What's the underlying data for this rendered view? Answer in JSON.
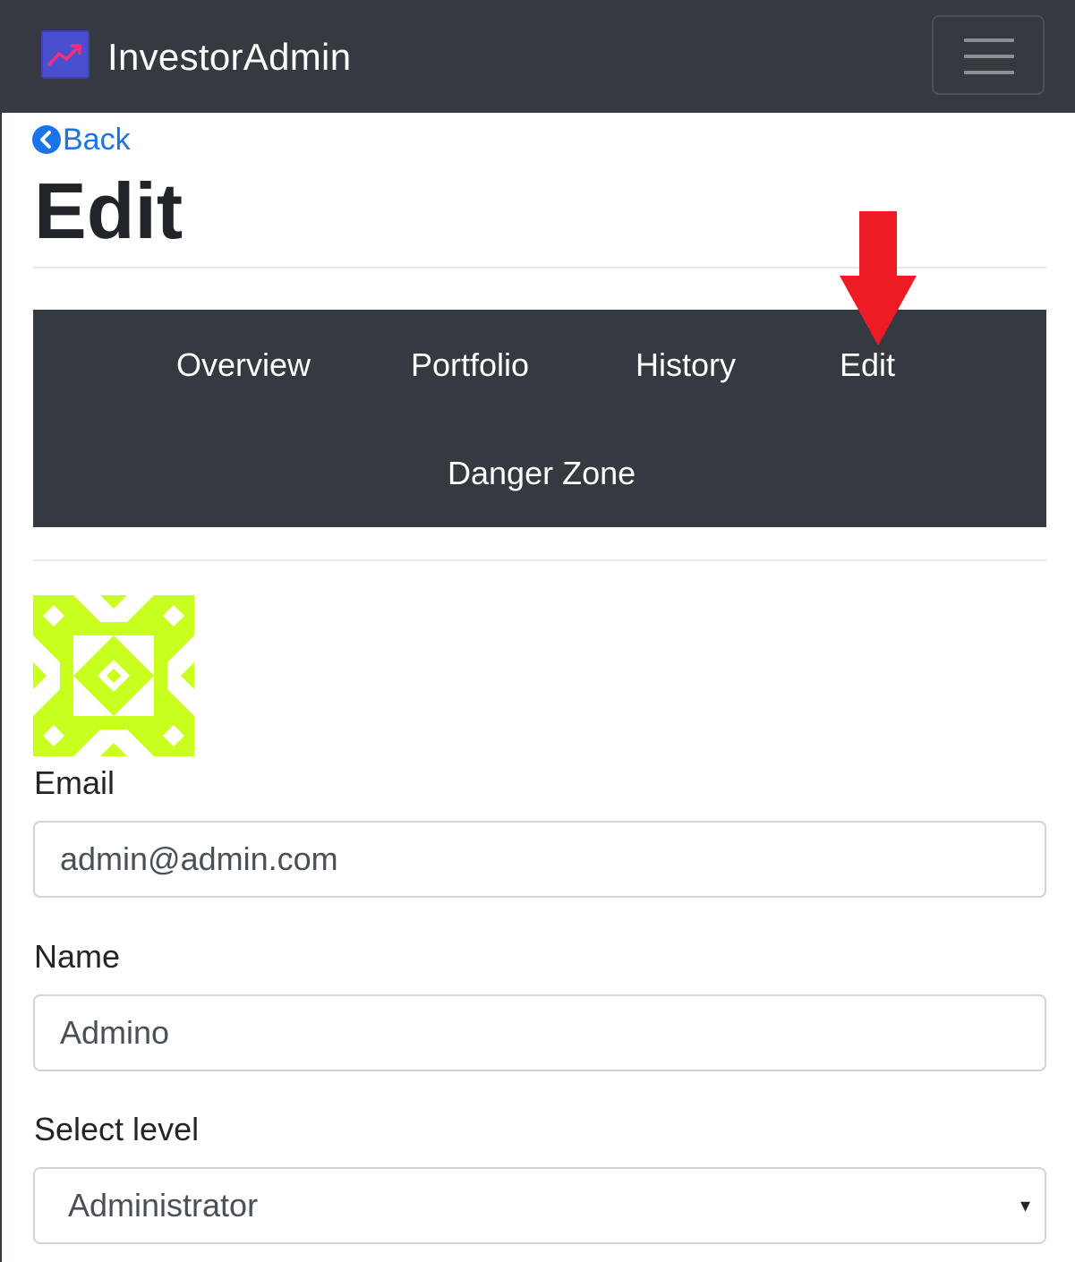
{
  "navbar": {
    "brand": "InvestorAdmin",
    "logo_icon": "trending-up-icon",
    "menu_icon": "hamburger-menu-icon"
  },
  "back": {
    "label": "Back",
    "icon": "chevron-left-circle-icon"
  },
  "page": {
    "title": "Edit"
  },
  "tabs": [
    {
      "label": "Overview"
    },
    {
      "label": "Portfolio"
    },
    {
      "label": "History"
    },
    {
      "label": "Edit"
    },
    {
      "label": "Danger Zone"
    }
  ],
  "annotation": {
    "arrow_icon": "red-down-arrow-icon",
    "arrow_color": "#ed1c24"
  },
  "avatar": {
    "icon": "identicon-avatar",
    "color": "#c8ff1c"
  },
  "form": {
    "email_label": "Email",
    "email_value": "admin@admin.com",
    "name_label": "Name",
    "name_value": "Admino",
    "level_label": "Select level",
    "level_value": "Administrator",
    "level_caret": "▾"
  },
  "colors": {
    "navbar_bg": "#343a40",
    "link": "#1a73e8"
  }
}
